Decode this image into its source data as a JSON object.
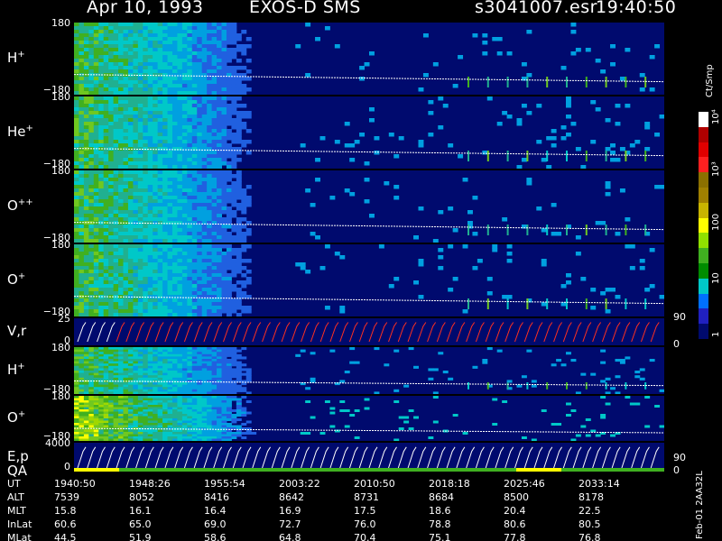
{
  "header": {
    "date": "Apr 10, 1993",
    "instrument": "EXOS-D SMS",
    "file": "s3041007.esr",
    "time": "19:40:50"
  },
  "panels": [
    {
      "label": "H",
      "sup": "+",
      "ytop": "180",
      "ybot": "−180"
    },
    {
      "label": "He",
      "sup": "+",
      "ytop": "180",
      "ybot": "−180"
    },
    {
      "label": "O",
      "sup": "++",
      "ytop": "180",
      "ybot": "−180"
    },
    {
      "label": "O",
      "sup": "+",
      "ytop": "180",
      "ybot": "−180"
    },
    {
      "label": "V,r",
      "sup": "",
      "ytop": "25",
      "ybot": "0",
      "right_top": "90",
      "right_bot": "0"
    },
    {
      "label": "H",
      "sup": "+",
      "ytop": "180",
      "ybot": "−180"
    },
    {
      "label": "O",
      "sup": "+",
      "ytop": "180",
      "ybot": "−180"
    },
    {
      "label": "E,p",
      "label2": "QA",
      "sup": "",
      "ytop": "4000",
      "ybot": "0",
      "right_top": "90",
      "right_bot": "0"
    }
  ],
  "colorbar": {
    "unit": "Ct/Smp",
    "ticks": [
      "10⁴",
      "10³",
      "100",
      "10",
      "1"
    ],
    "colors": [
      "#ffffff",
      "#b00000",
      "#e00000",
      "#ff2020",
      "#8b7000",
      "#a08000",
      "#c8b400",
      "#ffff00",
      "#90e000",
      "#40b020",
      "#008c00",
      "#00c8c8",
      "#0070ff",
      "#2020c0",
      "#000a6e"
    ]
  },
  "footer_note": "Feb-01 2AA32L",
  "orbit_table": {
    "rows": [
      {
        "label": "UT",
        "values": [
          "1940:50",
          "1948:26",
          "1955:54",
          "2003:22",
          "2010:50",
          "2018:18",
          "2025:46",
          "2033:14"
        ]
      },
      {
        "label": "ALT",
        "values": [
          "7539",
          "8052",
          "8416",
          "8642",
          "8731",
          "8684",
          "8500",
          "8178"
        ]
      },
      {
        "label": "MLT",
        "values": [
          "15.8",
          "16.1",
          "16.4",
          "16.9",
          "17.5",
          "18.6",
          "20.4",
          "22.5"
        ]
      },
      {
        "label": "InLat",
        "values": [
          "60.6",
          "65.0",
          "69.0",
          "72.7",
          "76.0",
          "78.8",
          "80.6",
          "80.5"
        ]
      },
      {
        "label": "MLat",
        "values": [
          "44.5",
          "51.9",
          "58.6",
          "64.8",
          "70.4",
          "75.1",
          "77.8",
          "76.8"
        ]
      }
    ]
  },
  "chart_data": {
    "type": "heatmap",
    "title": "Apr 10, 1993   EXOS-D SMS",
    "x_ticks": [
      "1940:50",
      "1948:26",
      "1955:54",
      "2003:22",
      "2010:50",
      "2018:18",
      "2025:46",
      "2033:14"
    ],
    "panels": [
      "H+",
      "He+",
      "O++",
      "O+",
      "V,r",
      "H+",
      "O+",
      "E,p QA"
    ],
    "ylim_pitch": [
      -180,
      180
    ],
    "colorbar_unit": "Ct/Smp",
    "colorbar_scale": "log",
    "colorbar_range": [
      1,
      10000
    ]
  }
}
